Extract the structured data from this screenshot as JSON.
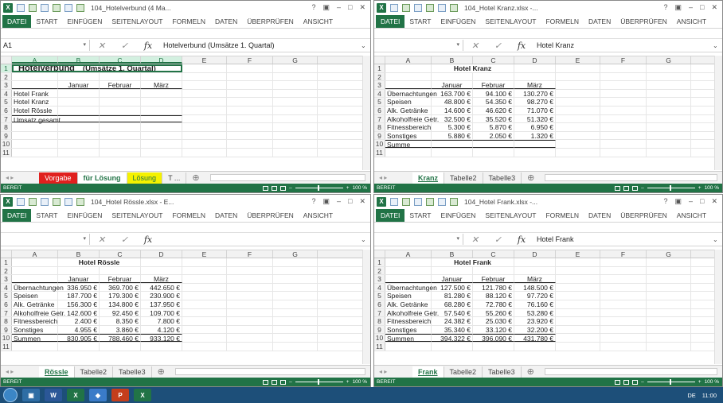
{
  "windows": [
    {
      "id": "verbund",
      "title": "104_Hotelverbund (4 Ma...",
      "name_box": "A1",
      "formula_value": "Hotelverbund   (Umsätze 1. Quartal)",
      "sheet_tabs": [
        "Vorgabe",
        "für Lösung",
        "Lösung",
        "T ..."
      ],
      "status": "BEREIT",
      "zoom": "100 %"
    },
    {
      "id": "kranz",
      "title": "104_Hotel Kranz.xlsx -...",
      "name_box": "",
      "formula_value": "Hotel Kranz",
      "sheet_tabs": [
        "Kranz",
        "Tabelle2",
        "Tabelle3"
      ],
      "status": "BEREIT",
      "zoom": "100 %"
    },
    {
      "id": "roessle",
      "title": "104_Hotel Rössle.xlsx - E...",
      "name_box": "",
      "formula_value": "",
      "sheet_tabs": [
        "Rössle",
        "Tabelle2",
        "Tabelle3"
      ],
      "status": "BEREIT",
      "zoom": "100 %"
    },
    {
      "id": "frank",
      "title": "104_Hotel Frank.xlsx -...",
      "name_box": "",
      "formula_value": "Hotel Frank",
      "sheet_tabs": [
        "Frank",
        "Tabelle2",
        "Tabelle3"
      ],
      "status": "BEREIT",
      "zoom": "100 %"
    }
  ],
  "ribbon_tabs": [
    "DATEI",
    "START",
    "EINFÜGEN",
    "SEITENLAYOUT",
    "FORMELN",
    "DATEN",
    "ÜBERPRÜFEN",
    "ANSICHT"
  ],
  "ribbon_tabs_short_last": "EN",
  "columns": [
    "A",
    "B",
    "C",
    "D",
    "E",
    "F",
    "G"
  ],
  "row_numbers": [
    "1",
    "2",
    "3",
    "4",
    "5",
    "6",
    "7",
    "8",
    "9",
    "10",
    "11"
  ],
  "verbund": {
    "title": "Hotelverbund",
    "subtitle": "(Umsätze 1. Quartal)",
    "months": [
      "Januar",
      "Februar",
      "März"
    ],
    "rows": [
      "Hotel Frank",
      "Hotel Kranz",
      "Hotel Rössle",
      "Umsatz gesamt"
    ]
  },
  "kranz": {
    "title": "Hotel Kranz",
    "months": [
      "Januar",
      "Februar",
      "März"
    ],
    "rows": [
      [
        "Übernachtungen",
        "163.700 €",
        "94.100 €",
        "130.270 €"
      ],
      [
        "Speisen",
        "48.800 €",
        "54.350 €",
        "98.270 €"
      ],
      [
        "Alk. Getränke",
        "14.600 €",
        "46.620 €",
        "71.070 €"
      ],
      [
        "Alkoholfreie Getr.",
        "32.500 €",
        "35.520 €",
        "51.320 €"
      ],
      [
        "Fitnessbereich",
        "5.300 €",
        "5.870 €",
        "6.950 €"
      ],
      [
        "Sonstiges",
        "5.880 €",
        "2.050 €",
        "1.320 €"
      ],
      [
        "Summe",
        "",
        "",
        ""
      ]
    ]
  },
  "roessle": {
    "title": "Hotel Rössle",
    "months": [
      "Januar",
      "Februar",
      "März"
    ],
    "rows": [
      [
        "Übernachtungen",
        "336.950 €",
        "369.700 €",
        "442.650 €"
      ],
      [
        "Speisen",
        "187.700 €",
        "179.300 €",
        "230.900 €"
      ],
      [
        "Alk. Getränke",
        "156.300 €",
        "134.800 €",
        "137.950 €"
      ],
      [
        "Alkoholfreie Getr.",
        "142.600 €",
        "92.450 €",
        "109.700 €"
      ],
      [
        "Fitnessbereich",
        "2.400 €",
        "8.350 €",
        "7.800 €"
      ],
      [
        "Sonstiges",
        "4.955 €",
        "3.860 €",
        "4.120 €"
      ],
      [
        "Summen",
        "830.905 €",
        "788.460 €",
        "933.120 €"
      ]
    ]
  },
  "frank": {
    "title": "Hotel Frank",
    "months": [
      "Januar",
      "Februar",
      "März"
    ],
    "rows": [
      [
        "Übernachtungen",
        "127.500 €",
        "121.780 €",
        "148.500 €"
      ],
      [
        "Speisen",
        "81.280 €",
        "88.120 €",
        "97.720 €"
      ],
      [
        "Alk. Getränke",
        "68.280 €",
        "72.780 €",
        "76.160 €"
      ],
      [
        "Alkoholfreie Getr.",
        "57.540 €",
        "55.260 €",
        "53.280 €"
      ],
      [
        "Fitnessbereich",
        "24.382 €",
        "25.030 €",
        "23.920 €"
      ],
      [
        "Sonstiges",
        "35.340 €",
        "33.120 €",
        "32.200 €"
      ],
      [
        "Summen",
        "394.322 €",
        "396.090 €",
        "431.780 €"
      ]
    ]
  },
  "taskbar": {
    "tray_lang": "DE",
    "clock": "11:00"
  },
  "colors": {
    "excel_green": "#217346",
    "tab_red": "#e0201e",
    "tab_yellow": "#f5f100"
  }
}
